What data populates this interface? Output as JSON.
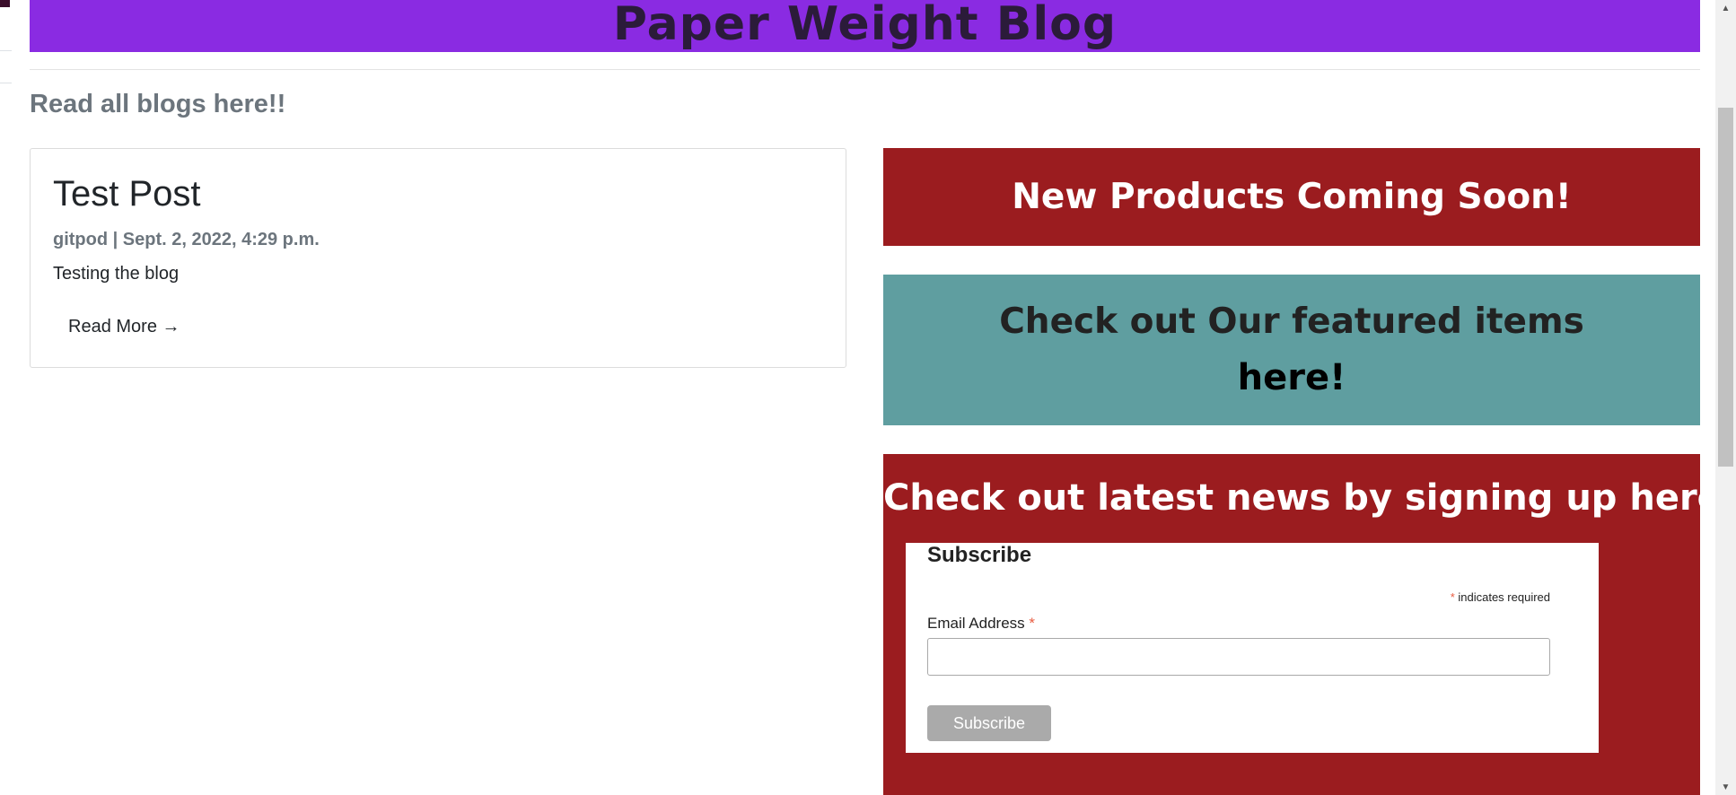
{
  "banner": {
    "title": "Paper Weight Blog"
  },
  "blog": {
    "subheading": "Read all blogs here!!",
    "posts": [
      {
        "title": "Test Post",
        "meta": "gitpod | Sept. 2, 2022, 4:29 p.m.",
        "excerpt": "Testing the blog",
        "read_more": "Read More →"
      }
    ]
  },
  "sidebar": {
    "products_promo": "New Products Coming Soon!",
    "featured_promo": {
      "text": "Check out Our featured items",
      "link": "here!"
    },
    "news_promo": "Check out latest news by signing up here!",
    "subscribe": {
      "heading": "Subscribe",
      "required_symbol": "*",
      "required_note": "indicates required",
      "email_label": "Email Address",
      "email_value": "",
      "button_label": "Subscribe"
    }
  },
  "colors": {
    "banner": "#8a2be2",
    "promo_red": "#9b1c1f",
    "promo_teal": "#5f9ea0",
    "muted_text": "#6c757d",
    "button_grey": "#aaaaaa",
    "required_red": "#e85c41"
  },
  "icons": {
    "scroll_up": "▲",
    "scroll_down": "▼"
  }
}
